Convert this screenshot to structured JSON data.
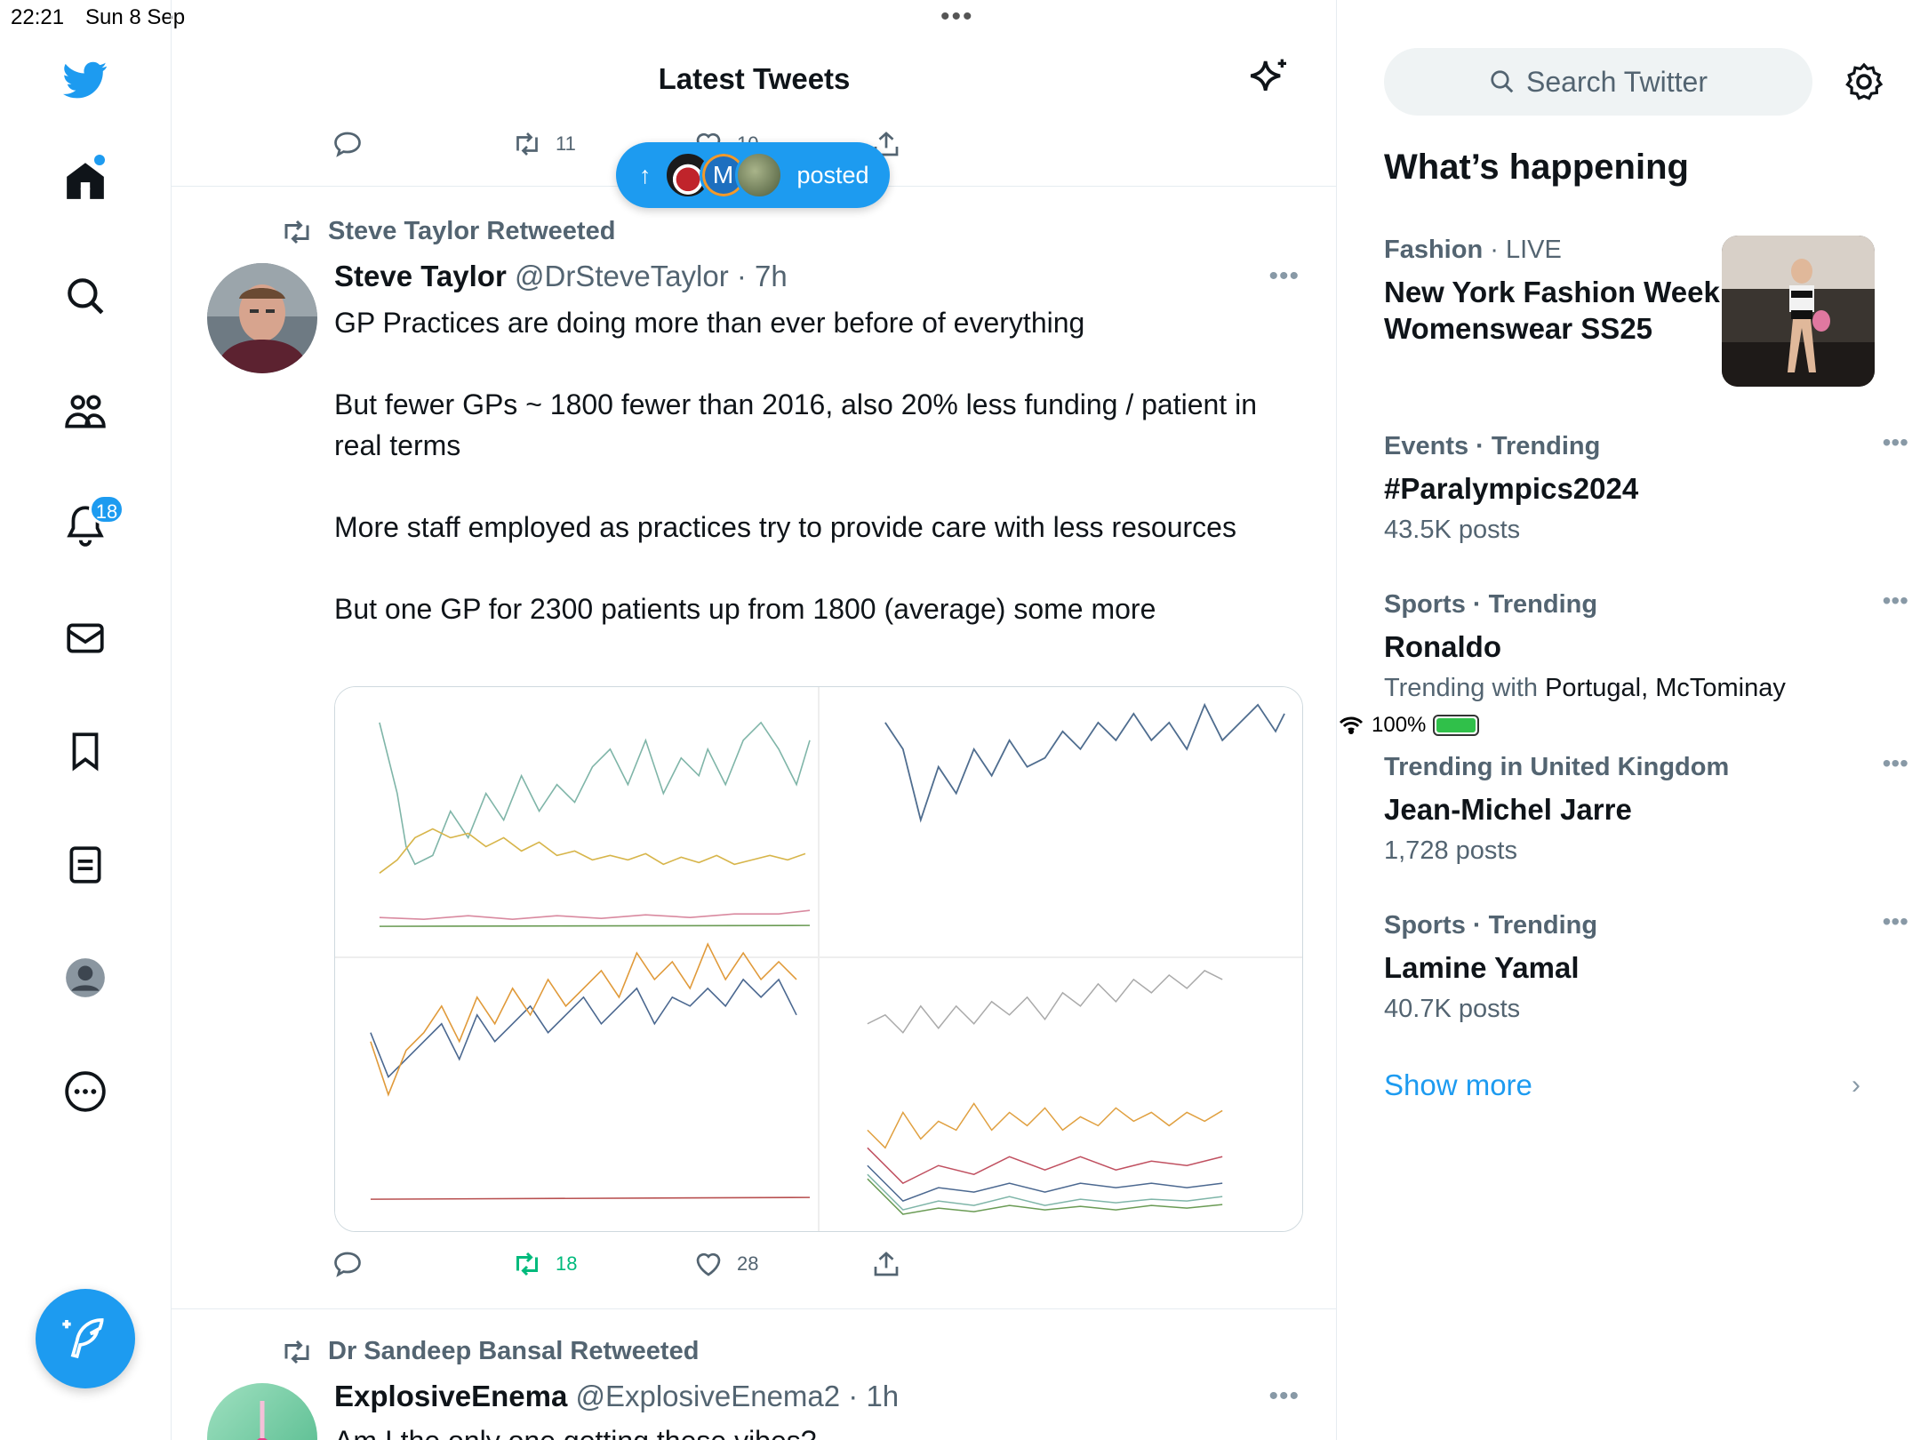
{
  "status": {
    "time": "22:21",
    "date": "Sun 8 Sep",
    "battery": "100%",
    "top_dots": "•••"
  },
  "nav": {
    "notifications_badge": "18"
  },
  "header": {
    "title": "Latest Tweets"
  },
  "prev_tweet": {
    "retweets": "11",
    "likes": "10"
  },
  "posted_pill": {
    "label": "posted",
    "avatar_letter": "M"
  },
  "tweet1": {
    "retweeted_by": "Steve Taylor Retweeted",
    "name": "Steve Taylor",
    "handle": "@DrSteveTaylor",
    "time": "· 7h",
    "more": "•••",
    "paragraphs": [
      "GP Practices are doing more than ever before of everything",
      "But fewer GPs ~ 1800 fewer than 2016, also 20% less funding / patient in real terms",
      "More staff employed as practices try to provide care with less resources",
      "But one GP for 2300 patients up from 1800 (average) some more"
    ],
    "retweets": "18",
    "likes": "28"
  },
  "tweet2": {
    "retweeted_by": "Dr Sandeep Bansal Retweeted",
    "name": "ExplosiveEnema",
    "handle": "@ExplosiveEnema2",
    "time": "· 1h",
    "more": "•••",
    "text": "Am I the only one getting these vibes?"
  },
  "sidebar": {
    "search_placeholder": "Search Twitter",
    "title": "What’s happening",
    "trends": [
      {
        "category": "Fashion",
        "qualifier": "· LIVE",
        "name": "New York Fashion Week Womenswear SS25"
      },
      {
        "category": "Events",
        "qualifier": "· Trending",
        "name": "#Paralympics2024",
        "count": "43.5K posts"
      },
      {
        "category": "Sports",
        "qualifier": "· Trending",
        "name": "Ronaldo",
        "count_prefix": "Trending with ",
        "count_dark": "Portugal, McTominay"
      },
      {
        "category": "Trending in United Kingdom",
        "qualifier": "",
        "name": "Jean-Michel Jarre",
        "count": "1,728 posts"
      },
      {
        "category": "Sports",
        "qualifier": "· Trending",
        "name": "Lamine Yamal",
        "count": "40.7K posts"
      }
    ],
    "show_more": "Show more"
  },
  "colors": {
    "accent": "#1d9bf0",
    "secondary_text": "#536471",
    "retweet_green": "#00ba7c"
  }
}
